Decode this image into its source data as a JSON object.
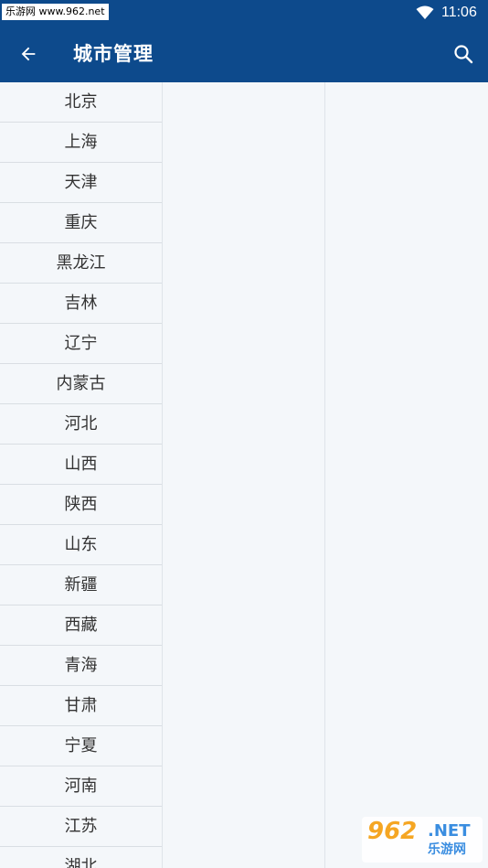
{
  "status_bar": {
    "watermark_text": "乐游网 www.962.net",
    "time": "11:06",
    "wifi_icon": "wifi-icon"
  },
  "app_bar": {
    "title": "城市管理",
    "back_icon": "arrow-left-icon",
    "search_icon": "search-icon",
    "color": "#0d4a8c"
  },
  "provinces": [
    "北京",
    "上海",
    "天津",
    "重庆",
    "黑龙江",
    "吉林",
    "辽宁",
    "内蒙古",
    "河北",
    "山西",
    "陕西",
    "山东",
    "新疆",
    "西藏",
    "青海",
    "甘肃",
    "宁夏",
    "河南",
    "江苏",
    "湖北"
  ],
  "watermark": {
    "main": "962",
    "suffix": ".NET",
    "sub": "乐游网"
  }
}
